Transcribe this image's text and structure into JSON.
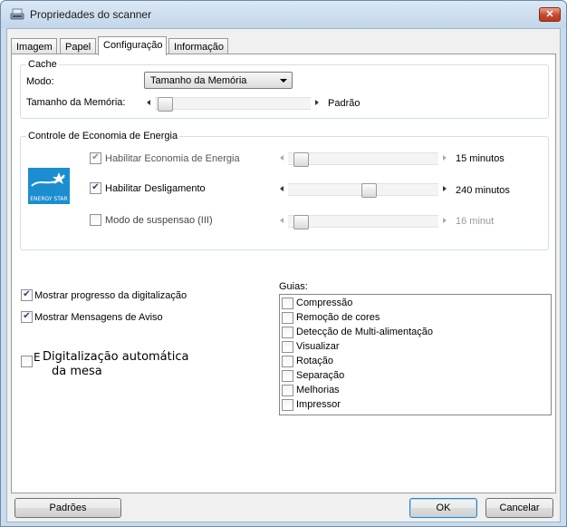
{
  "window": {
    "title": "Propriedades do scanner",
    "close_label": "✕"
  },
  "tabs": [
    {
      "label": "Imagem"
    },
    {
      "label": "Papel"
    },
    {
      "label": "Configuração"
    },
    {
      "label": "Informação"
    }
  ],
  "active_tab": "Configuração",
  "cache": {
    "group_label": "Cache",
    "mode_label": "Modo:",
    "mode_value": "Tamanho da Memória",
    "memory_label": "Tamanho da Memória:",
    "memory_value": "Padrão",
    "memory_slider_position": 0
  },
  "energy": {
    "group_label": "Controle de Economia de Energia",
    "logo_text": "ENERGY STAR",
    "rows": [
      {
        "label": "Habilitar Economia de Energia",
        "checked": true,
        "enabled": false,
        "value": "15 minutos",
        "slider_position": 0.03
      },
      {
        "label": "Habilitar Desligamento",
        "checked": true,
        "enabled": true,
        "value": "240 minutos",
        "slider_position": 0.53
      },
      {
        "label": "Modo de suspensao (III)",
        "checked": false,
        "enabled": false,
        "value": "16 minut",
        "slider_position": 0.03
      }
    ]
  },
  "options": [
    {
      "label": "Mostrar progresso da digitalização",
      "checked": true
    },
    {
      "label": "Mostrar Mensagens de Aviso",
      "checked": true
    },
    {
      "label": "E",
      "checked": false
    },
    {
      "label": "Digitalização automática",
      "checked": false
    },
    {
      "label": "da mesa",
      "checked": false
    }
  ],
  "guias": {
    "label": "Guias:",
    "items": [
      {
        "label": "Compressão",
        "checked": false
      },
      {
        "label": "Remoção de cores",
        "checked": false
      },
      {
        "label": "Detecção de Multi-alimentação",
        "checked": false
      },
      {
        "label": "Visualizar",
        "checked": false
      },
      {
        "label": "Rotação",
        "checked": false
      },
      {
        "label": "Separação",
        "checked": false
      },
      {
        "label": "Melhorias",
        "checked": false
      },
      {
        "label": "Impressor",
        "checked": false
      }
    ]
  },
  "buttons": {
    "defaults": "Padrões",
    "ok": "OK",
    "cancel": "Cancelar"
  },
  "colors": {
    "titlebar": "#c9dcee",
    "energy_logo": "#1a8ed0",
    "checkmark": "#2a3f86"
  }
}
